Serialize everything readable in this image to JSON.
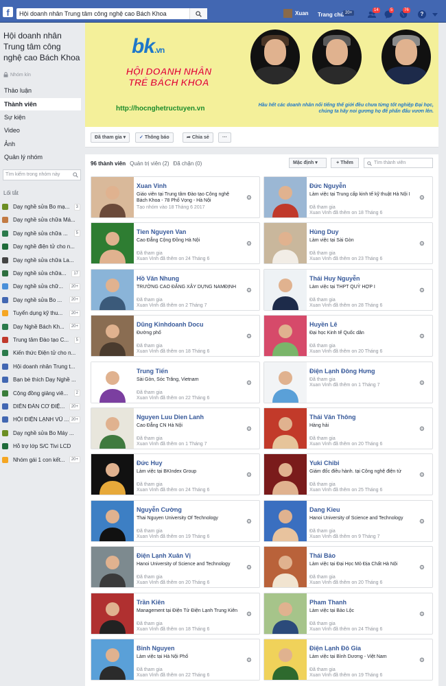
{
  "topbar": {
    "search_value": "Hội doanh nhân Trung tâm công nghệ cao Bách Khoa",
    "user_name": "Xuan",
    "home_label": "Trang chủ",
    "home_badge": "20+",
    "friend_badge": "14",
    "msg_badge": "5",
    "notif_badge": "76",
    "help": "?"
  },
  "group": {
    "title": "Hội doanh nhân Trung tâm công nghệ cao Bách Khoa",
    "privacy": "Nhóm kín"
  },
  "nav": [
    "Thảo luận",
    "Thành viên",
    "Sự kiện",
    "Video",
    "Ảnh",
    "Quản lý nhóm"
  ],
  "sidebar_search_placeholder": "Tìm kiếm trong nhóm này",
  "shortcuts_title": "Lối tắt",
  "shortcuts": [
    {
      "label": "Dạy nghề sửa Bo mạ...",
      "count": "3",
      "color": "#6b8e23"
    },
    {
      "label": "Dạy nghề sửa chữa Má...",
      "count": "",
      "color": "#c27a43"
    },
    {
      "label": "Dạy nghề sửa chữa ...",
      "count": "5",
      "color": "#2b7a4b"
    },
    {
      "label": "Dạy nghề điện tử cho n...",
      "count": "",
      "color": "#1f6b3a"
    },
    {
      "label": "Dạy nghề sửa chữa La...",
      "count": "",
      "color": "#444444"
    },
    {
      "label": "Dạy nghề sửa chữa...",
      "count": "17",
      "color": "#2d6e3e"
    },
    {
      "label": "Dạy nghề sửa chữ...",
      "count": "20+",
      "color": "#4a90d9"
    },
    {
      "label": "Dạy nghề sửa Bo ...",
      "count": "20+",
      "color": "#4267b2"
    },
    {
      "label": "Tuyển dụng kỹ thu...",
      "count": "20+",
      "color": "#f5a623"
    },
    {
      "label": "Dạy Nghề Bách Kh...",
      "count": "20+",
      "color": "#2b7a4b"
    },
    {
      "label": "Trung tâm Đào tạo C...",
      "count": "5",
      "color": "#c0392b"
    },
    {
      "label": "Kiến thức Điện tử cho n...",
      "count": "",
      "color": "#2b7a4b"
    },
    {
      "label": "Hội doanh nhân Trung t...",
      "count": "",
      "color": "#4267b2"
    },
    {
      "label": "Bạn bè thích Dạy Nghề ...",
      "count": "",
      "color": "#4267b2"
    },
    {
      "label": "Cộng đồng giảng viê...",
      "count": "2",
      "color": "#3a7d3a"
    },
    {
      "label": "DIỄN ĐÀN CƠ ĐIỆ...",
      "count": "20+",
      "color": "#4267b2"
    },
    {
      "label": "HỘI ĐIỆN LẠNH VŨ ...",
      "count": "20+",
      "color": "#4267b2"
    },
    {
      "label": "Dạy nghề sửa Bo Máy ...",
      "count": "",
      "color": "#6b8e23"
    },
    {
      "label": "Hỗ trợ lớp S/C Tivi LCD",
      "count": "",
      "color": "#1f6b3a"
    },
    {
      "label": "Nhóm gái 1 con kết...",
      "count": "20+",
      "color": "#f5a623"
    }
  ],
  "cover": {
    "logo_main": "bk",
    "logo_suffix": ".vn",
    "logo_line1": "HỘI DOANH NHÂN",
    "logo_line2": "TRẺ BÁCH KHOA",
    "url": "http://hocnghetructuyen.vn",
    "caption": "Hầu hết các doanh nhân nổi tiếng thế giới đều chưa từng tốt nghiệp Đại học, chúng ta hãy noi gương họ để phấn đấu vươn lên."
  },
  "actions": {
    "joined": "Đã tham gia",
    "notifications": "Thông báo",
    "share": "Chia sẻ",
    "more": "···"
  },
  "members_bar": {
    "count_tab": "96 thành viên",
    "admins_tab": "Quản trị viên (2)",
    "blocked_tab": "Đã chặn (0)",
    "sort": "Mặc định",
    "add": "Thêm",
    "search_placeholder": "Tìm thành viên"
  },
  "members": [
    {
      "name": "Xuan Vinh",
      "desc": "Giáo viên tại Trung tâm Đào tạo Công nghệ Bách Khoa - 78 Phố Vọng - Hà Nội",
      "d2": "Tạo nhóm vào 18 Tháng 6 2017",
      "d3": "",
      "c1": "#d9b99a",
      "c2": "#6b4a3a"
    },
    {
      "name": "Đức Nguyễn",
      "desc": "Làm việc tại Trung cấp kinh tế kỹ thuật Hà Nội I",
      "d2": "Đã tham gia",
      "d3": "Xuan Vinh đã thêm on 18 Tháng 6",
      "c1": "#9bb7d4",
      "c2": "#c0392b"
    },
    {
      "name": "Tien Nguyen Van",
      "desc": "Cao Đẳng Cộng Đồng Hà Nội",
      "d2": "Đã tham gia",
      "d3": "Xuan Vinh đã thêm on 24 Tháng 6",
      "c1": "#2e7d32",
      "c2": "#e0b28f"
    },
    {
      "name": "Hùng Duy",
      "desc": "Làm việc tại Sài Gòn",
      "d2": "Đã tham gia",
      "d3": "Xuan Vinh đã thêm on 23 Tháng 6",
      "c1": "#c9b79c",
      "c2": "#f2ede6"
    },
    {
      "name": "Hồ Văn Nhung",
      "desc": "TRƯỜNG CAO ĐẲNG XÂY DỰNG NAMĐỊNH",
      "d2": "Đã tham gia",
      "d3": "Xuan Vinh đã thêm on 2 Tháng 7",
      "c1": "#8ab4d8",
      "c2": "#3b5a7a"
    },
    {
      "name": "Thái Huy Nguyễn",
      "desc": "Làm việc tại THPT QUỲ HỢP I",
      "d2": "Đã tham gia",
      "d3": "Xuan Vinh đã thêm on 28 Tháng 6",
      "c1": "#eef2f5",
      "c2": "#1d2b4a"
    },
    {
      "name": "Dũng Kinhdoanh Docu",
      "desc": "Đường phố",
      "d2": "Đã tham gia",
      "d3": "Xuan Vinh đã thêm on 18 Tháng 6",
      "c1": "#8a6d52",
      "c2": "#4a3b2e"
    },
    {
      "name": "Huyền Lê",
      "desc": "Đại học Kinh tế Quốc dân",
      "d2": "Đã tham gia",
      "d3": "Xuan Vinh đã thêm on 20 Tháng 6",
      "c1": "#d64a6a",
      "c2": "#7ab56a"
    },
    {
      "name": "Trung Tiến",
      "desc": "Sài Gòn, Sóc Trăng, Vietnam",
      "d2": "Đã tham gia",
      "d3": "Xuan Vinh đã thêm on 22 Tháng 6",
      "c1": "#ffffff",
      "c2": "#7b3fa0"
    },
    {
      "name": "Điện Lạnh Đông Hưng",
      "desc": "",
      "d2": "Đã tham gia",
      "d3": "Xuan Vinh đã thêm on 1 Tháng 7",
      "c1": "#f2f4f6",
      "c2": "#5aa0d8"
    },
    {
      "name": "Nguyen Luu Dien Lanh",
      "desc": "Cao Đẳng CN Hà Nội",
      "d2": "Đã tham gia",
      "d3": "Xuan Vinh đã thêm on 1 Tháng 7",
      "c1": "#e8e6dc",
      "c2": "#3f7a3f"
    },
    {
      "name": "Thái Văn Thông",
      "desc": "Hàng hải",
      "d2": "Đã tham gia",
      "d3": "Xuan Vinh đã thêm on 20 Tháng 6",
      "c1": "#c23a2a",
      "c2": "#e6c49a"
    },
    {
      "name": "Đức Huy",
      "desc": "Làm việc tại BKIndex Group",
      "d2": "Đã tham gia",
      "d3": "Xuan Vinh đã thêm on 24 Tháng 6",
      "c1": "#111111",
      "c2": "#e7a93a"
    },
    {
      "name": "Yuki Chibi",
      "desc": "Giám đốc điều hành. tại Công nghệ điện tử",
      "d2": "Đã tham gia",
      "d3": "Xuan Vinh đã thêm on 25 Tháng 6",
      "c1": "#7a1b1b",
      "c2": "#e0b28f"
    },
    {
      "name": "Nguyễn Cường",
      "desc": "Thai Nguyen University Of Technology",
      "d2": "Đã tham gia",
      "d3": "Xuan Vinh đã thêm on 19 Tháng 6",
      "c1": "#3d7fc4",
      "c2": "#111111"
    },
    {
      "name": "Dang Kieu",
      "desc": "Hanoi University of Science and Technology",
      "d2": "Đã tham gia",
      "d3": "Xuan Vinh đã thêm on 9 Tháng 7",
      "c1": "#3a6fc0",
      "c2": "#e8c39e"
    },
    {
      "name": "Điện Lạnh Xuân Vị",
      "desc": "Hanoi University of Science and Technology",
      "d2": "Đã tham gia",
      "d3": "Xuan Vinh đã thêm on 20 Tháng 6",
      "c1": "#7d8a8f",
      "c2": "#3a3a3a"
    },
    {
      "name": "Thái Bảo",
      "desc": "Làm việc tại Đại Học Mỏ Địa Chất Hà Nội",
      "d2": "Đã tham gia",
      "d3": "Xuan Vinh đã thêm on 20 Tháng 6",
      "c1": "#b9623a",
      "c2": "#f1e4d0"
    },
    {
      "name": "Trần Kiên",
      "desc": "Management tại Điện Tử Điện Lạnh Trung Kiên",
      "d2": "Đã tham gia",
      "d3": "Xuan Vinh đã thêm on 18 Tháng 6",
      "c1": "#b03030",
      "c2": "#222222"
    },
    {
      "name": "Pham Thanh",
      "desc": "Làm việc tại Bảo Lộc",
      "d2": "Đã tham gia",
      "d3": "Xuan Vinh đã thêm on 24 Tháng 6",
      "c1": "#a6c48a",
      "c2": "#2b4a7a"
    },
    {
      "name": "Binh Nguyen",
      "desc": "Làm việc tại Hà Nội Phố",
      "d2": "Đã tham gia",
      "d3": "Xuan Vinh đã thêm on 22 Tháng 6",
      "c1": "#5aa0d8",
      "c2": "#2b2b2b"
    },
    {
      "name": "Điện Lạnh Đô Gia",
      "desc": "Làm việc tại Bình Dương - Việt Nam",
      "d2": "Đã tham gia",
      "d3": "Xuan Vinh đã thêm on 19 Tháng 6",
      "c1": "#f0d25a",
      "c2": "#2e6a2e"
    }
  ]
}
